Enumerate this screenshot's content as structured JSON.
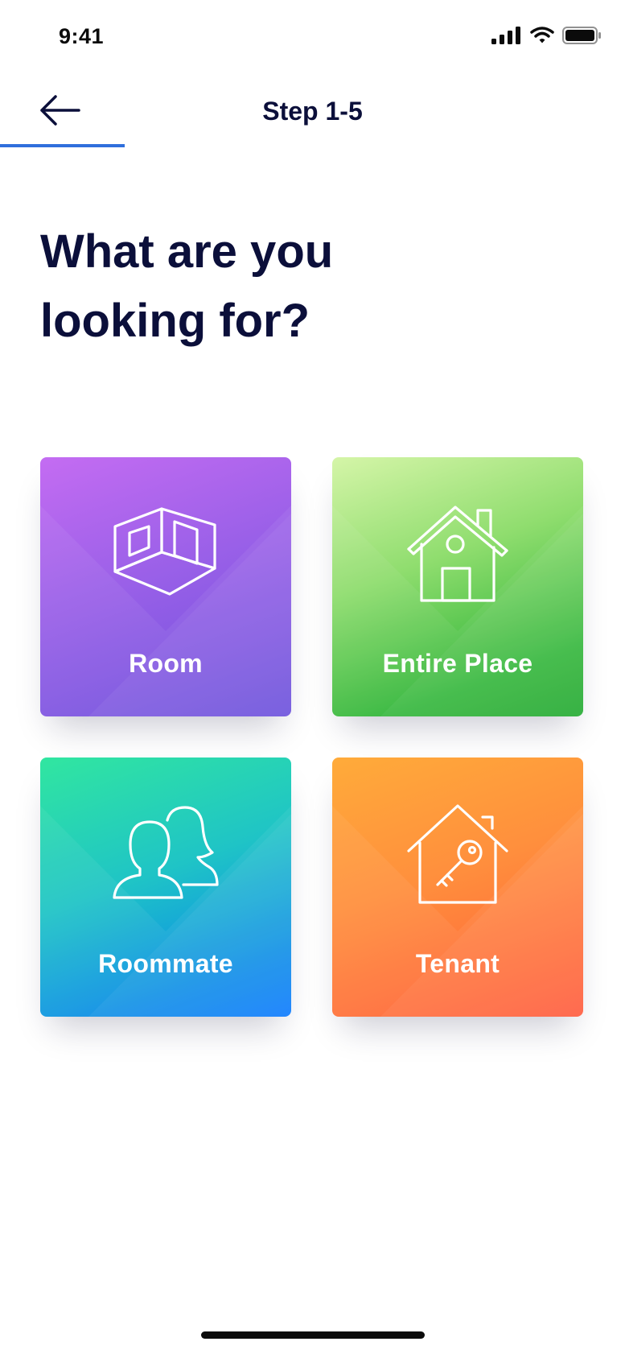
{
  "status_bar": {
    "time": "9:41",
    "icons": [
      "signal-icon",
      "wifi-icon",
      "battery-icon"
    ]
  },
  "nav": {
    "back_icon": "arrow-left-icon",
    "title": "Step 1-5",
    "progress": 0.2,
    "progress_color": "#2f6fdc"
  },
  "heading": {
    "line1": "What are you",
    "line2": "looking for?"
  },
  "options": [
    {
      "label": "Room",
      "icon": "room-cube-icon",
      "colors": [
        "#c46cf2",
        "#6a4fdc"
      ]
    },
    {
      "label": "Entire Place",
      "icon": "house-icon",
      "colors": [
        "#d5f5a8",
        "#21a92f"
      ]
    },
    {
      "label": "Roommate",
      "icon": "people-icon",
      "colors": [
        "#31e6a0",
        "#0a79ff"
      ]
    },
    {
      "label": "Tenant",
      "icon": "house-key-icon",
      "colors": [
        "#ffab3a",
        "#ff5a3c"
      ]
    }
  ],
  "colors": {
    "text_primary": "#0b0f3a",
    "accent": "#2f6fdc"
  }
}
